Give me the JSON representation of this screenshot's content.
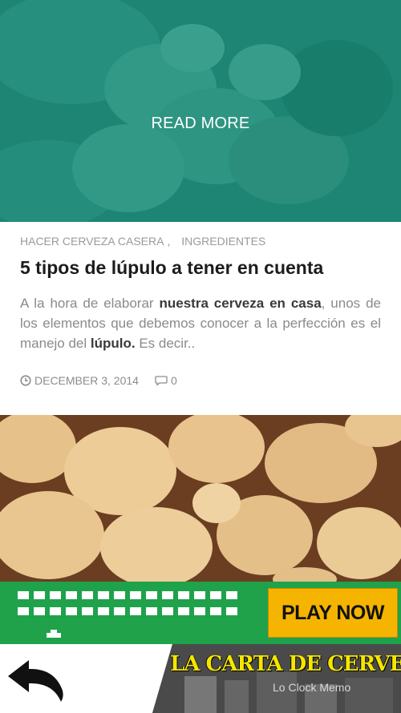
{
  "hero": {
    "read_more": "READ MORE"
  },
  "post": {
    "categories": [
      "HACER CERVEZA CASERA",
      "INGREDIENTES"
    ],
    "category_separator": ",",
    "title": "5 tipos de lúpulo a tener en cuenta",
    "excerpt": {
      "part1": "A la hora de elaborar ",
      "bold1": "nuestra cerveza en casa",
      "part2": ", unos de los elementos que debemos conocer a la perfección es el manejo del ",
      "bold2": "lúpulo.",
      "part3": " Es decir.."
    },
    "date": "DECEMBER 3, 2014",
    "comments": "0"
  },
  "ad": {
    "play_label": "PLAY NOW"
  },
  "footer": {
    "brand_title": "LA CARTA DE CERVEZA",
    "watermark": "Lo Clock Memo"
  },
  "colors": {
    "accent_teal": "#148c78",
    "ad_green": "#1fa24a",
    "ad_button": "#f5b400",
    "brand_yellow": "#f5e600"
  }
}
